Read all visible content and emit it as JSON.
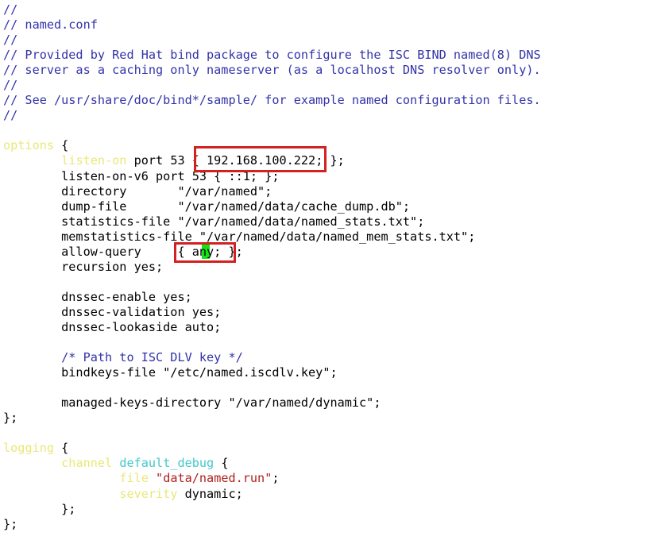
{
  "document": {
    "filename": "named.conf",
    "language": "bind-config"
  },
  "theme": {
    "background": "#ffffff",
    "foreground": "#000000",
    "comment_color": "#3333aa",
    "keyword_color": "#e8e87a",
    "identifier_color": "#44c8c8",
    "string_color": "#b02020",
    "annotation_color": "#d32020",
    "cursor_color": "#12e612"
  },
  "lines": [
    {
      "n": 1,
      "tokens": [
        {
          "t": "comment",
          "s": "//"
        }
      ]
    },
    {
      "n": 2,
      "tokens": [
        {
          "t": "comment",
          "s": "// named.conf"
        }
      ]
    },
    {
      "n": 3,
      "tokens": [
        {
          "t": "comment",
          "s": "//"
        }
      ]
    },
    {
      "n": 4,
      "tokens": [
        {
          "t": "comment",
          "s": "// Provided by Red Hat bind package to configure the ISC BIND named(8) DNS"
        }
      ]
    },
    {
      "n": 5,
      "tokens": [
        {
          "t": "comment",
          "s": "// server as a caching only nameserver (as a localhost DNS resolver only)."
        }
      ]
    },
    {
      "n": 6,
      "tokens": [
        {
          "t": "comment",
          "s": "//"
        }
      ]
    },
    {
      "n": 7,
      "tokens": [
        {
          "t": "comment",
          "s": "// See /usr/share/doc/bind*/sample/ for example named configuration files."
        }
      ]
    },
    {
      "n": 8,
      "tokens": [
        {
          "t": "comment",
          "s": "//"
        }
      ]
    },
    {
      "n": 9,
      "tokens": []
    },
    {
      "n": 10,
      "tokens": [
        {
          "t": "keyword",
          "s": "options"
        },
        {
          "t": "plain",
          "s": " {"
        }
      ]
    },
    {
      "n": 11,
      "tokens": [
        {
          "t": "plain",
          "s": "        "
        },
        {
          "t": "keyword",
          "s": "listen-on"
        },
        {
          "t": "plain",
          "s": " port 53 { 192.168.100.222; };"
        }
      ]
    },
    {
      "n": 12,
      "tokens": [
        {
          "t": "plain",
          "s": "        listen-on-v6 port 53 { ::1; };"
        }
      ]
    },
    {
      "n": 13,
      "tokens": [
        {
          "t": "plain",
          "s": "        directory       \"/var/named\";"
        }
      ]
    },
    {
      "n": 14,
      "tokens": [
        {
          "t": "plain",
          "s": "        dump-file       \"/var/named/data/cache_dump.db\";"
        }
      ]
    },
    {
      "n": 15,
      "tokens": [
        {
          "t": "plain",
          "s": "        statistics-file \"/var/named/data/named_stats.txt\";"
        }
      ]
    },
    {
      "n": 16,
      "tokens": [
        {
          "t": "plain",
          "s": "        memstatistics-file \"/var/named/data/named_mem_stats.txt\";"
        }
      ]
    },
    {
      "n": 17,
      "tokens": [
        {
          "t": "plain",
          "s": "        allow-query     { any; };"
        }
      ]
    },
    {
      "n": 18,
      "tokens": [
        {
          "t": "plain",
          "s": "        recursion yes;"
        }
      ]
    },
    {
      "n": 19,
      "tokens": []
    },
    {
      "n": 20,
      "tokens": [
        {
          "t": "plain",
          "s": "        dnssec-enable yes;"
        }
      ]
    },
    {
      "n": 21,
      "tokens": [
        {
          "t": "plain",
          "s": "        dnssec-validation yes;"
        }
      ]
    },
    {
      "n": 22,
      "tokens": [
        {
          "t": "plain",
          "s": "        dnssec-lookaside auto;"
        }
      ]
    },
    {
      "n": 23,
      "tokens": []
    },
    {
      "n": 24,
      "tokens": [
        {
          "t": "plain",
          "s": "        "
        },
        {
          "t": "comment",
          "s": "/* Path to ISC DLV key */"
        }
      ]
    },
    {
      "n": 25,
      "tokens": [
        {
          "t": "plain",
          "s": "        bindkeys-file \"/etc/named.iscdlv.key\";"
        }
      ]
    },
    {
      "n": 26,
      "tokens": []
    },
    {
      "n": 27,
      "tokens": [
        {
          "t": "plain",
          "s": "        managed-keys-directory \"/var/named/dynamic\";"
        }
      ]
    },
    {
      "n": 28,
      "tokens": [
        {
          "t": "plain",
          "s": "};"
        }
      ]
    },
    {
      "n": 29,
      "tokens": []
    },
    {
      "n": 30,
      "tokens": [
        {
          "t": "keyword",
          "s": "logging"
        },
        {
          "t": "plain",
          "s": " {"
        }
      ]
    },
    {
      "n": 31,
      "tokens": [
        {
          "t": "plain",
          "s": "        "
        },
        {
          "t": "keyword",
          "s": "channel"
        },
        {
          "t": "plain",
          "s": " "
        },
        {
          "t": "ident",
          "s": "default_debug"
        },
        {
          "t": "plain",
          "s": " {"
        }
      ]
    },
    {
      "n": 32,
      "tokens": [
        {
          "t": "plain",
          "s": "                "
        },
        {
          "t": "keyword",
          "s": "file"
        },
        {
          "t": "plain",
          "s": " "
        },
        {
          "t": "string",
          "s": "\"data/named.run\""
        },
        {
          "t": "plain",
          "s": ";"
        }
      ]
    },
    {
      "n": 33,
      "tokens": [
        {
          "t": "plain",
          "s": "                "
        },
        {
          "t": "keyword",
          "s": "severity"
        },
        {
          "t": "plain",
          "s": " dynamic;"
        }
      ]
    },
    {
      "n": 34,
      "tokens": [
        {
          "t": "plain",
          "s": "        };"
        }
      ]
    },
    {
      "n": 35,
      "tokens": [
        {
          "t": "plain",
          "s": "};"
        }
      ]
    }
  ],
  "annotations": [
    {
      "id": "annot-ip",
      "label": "listen-on-address-highlight",
      "highlighted_text": "192.168.100.222;",
      "color": "#d32020"
    },
    {
      "id": "annot-allow",
      "label": "allow-query-value-highlight",
      "highlighted_text": "{ any; };",
      "color": "#d32020"
    }
  ],
  "cursor": {
    "label": "text-cursor",
    "character": "y",
    "line": 17,
    "color": "#12e612"
  }
}
